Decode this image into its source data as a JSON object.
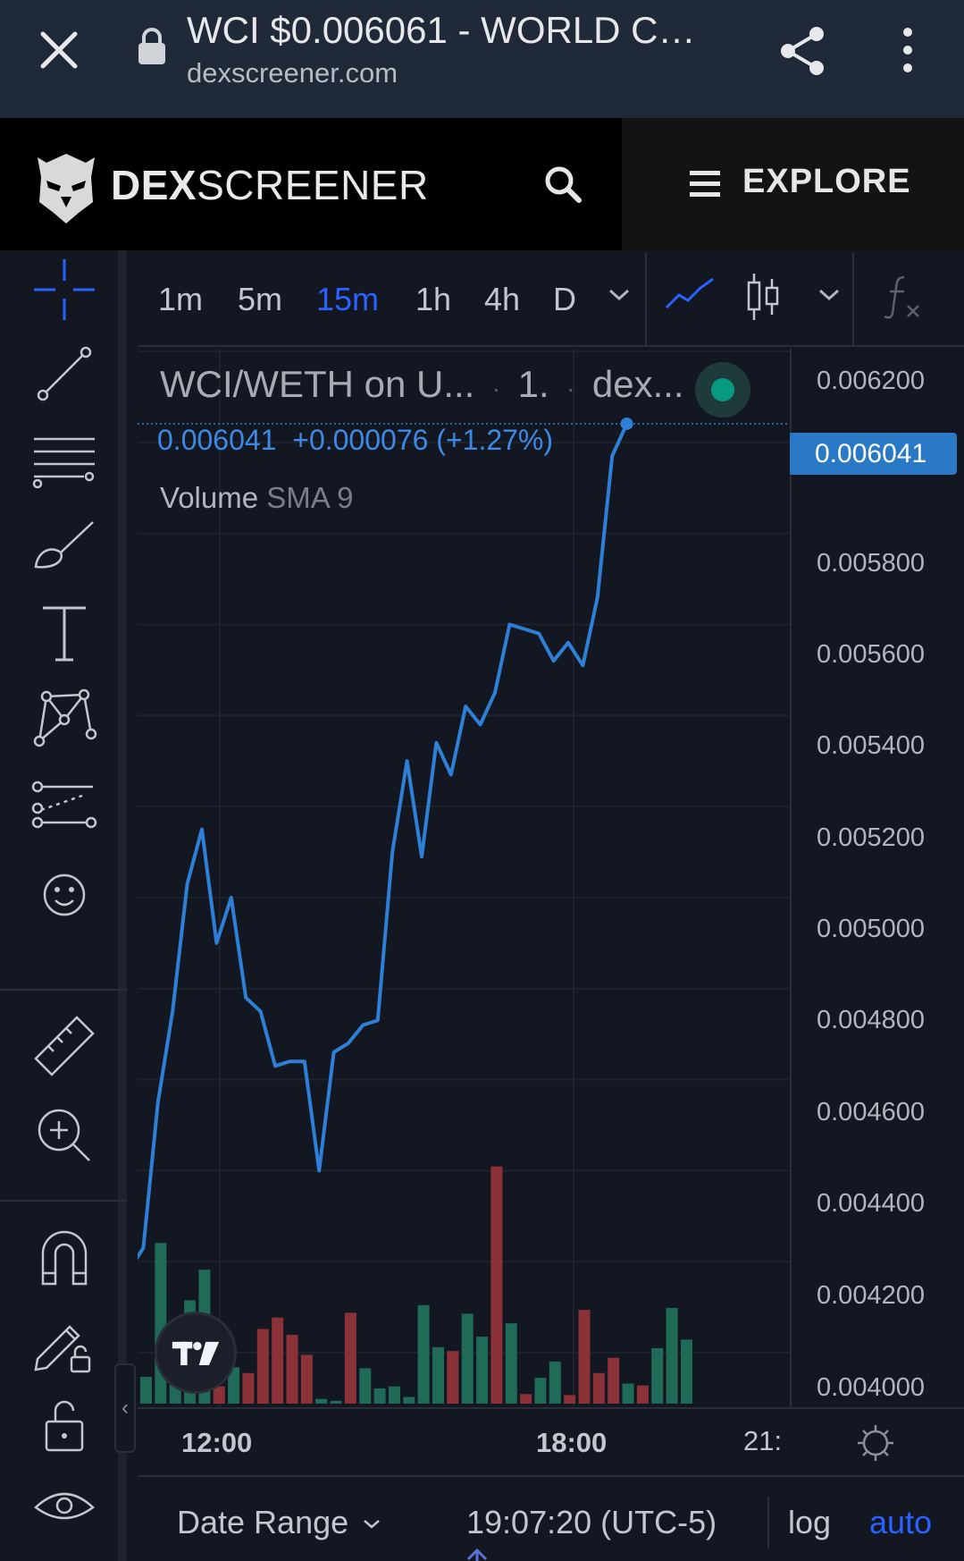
{
  "browser": {
    "title": "WCI $0.006061 - WORLD CU...",
    "domain": "dexscreener.com",
    "icons": [
      "close-icon",
      "lock-icon",
      "share-icon",
      "more-vert-icon"
    ]
  },
  "header": {
    "brand_bold": "DEX",
    "brand_rest": "SCREENER",
    "explore_label": "EXPLORE",
    "icons": [
      "eagle-logo-icon",
      "search-icon",
      "menu-icon"
    ]
  },
  "toolbar": {
    "timeframes": [
      "1m",
      "5m",
      "15m",
      "1h",
      "4h",
      "D"
    ],
    "active_timeframe": "15m",
    "icons": [
      "crosshair-icon",
      "trend-line-icon",
      "fib-lines-icon",
      "brush-icon",
      "text-icon",
      "pattern-icon",
      "forecast-icon",
      "emoji-icon",
      "ruler-icon",
      "zoom-in-icon",
      "magnet-icon",
      "lock-pencil-icon",
      "unlock-icon",
      "eye-icon",
      "line-chart-icon",
      "candles-icon",
      "indicators-icon"
    ]
  },
  "legend": {
    "pair": "WCI/WETH on U...",
    "interval": "1.",
    "source": "dex...",
    "price": "0.006041",
    "change": "+0.000076 (+1.27%)",
    "volume_label": "Volume",
    "volume_sma": "SMA 9"
  },
  "price_axis": {
    "ticks": [
      "0.006200",
      "0.005800",
      "0.005600",
      "0.005400",
      "0.005200",
      "0.005000",
      "0.004800",
      "0.004600",
      "0.004400",
      "0.004200",
      "0.004000"
    ],
    "current": "0.006041"
  },
  "time_axis": {
    "ticks": [
      "12:00",
      "18:00"
    ],
    "cut": "21:"
  },
  "bottom": {
    "date_range": "Date Range",
    "time": "19:07:20 (UTC-5)",
    "log": "log",
    "auto": "auto"
  },
  "colors": {
    "line": "#2e7fd6",
    "up": "#1f6b57",
    "down": "#8b3138",
    "accent": "#2962ff"
  },
  "chart_data": {
    "type": "line",
    "ylim": [
      0.004,
      0.0062
    ],
    "series": [
      {
        "values": [
          0.00418,
          0.00423,
          0.00455,
          0.00475,
          0.00503,
          0.00515,
          0.0049,
          0.005,
          0.00478,
          0.00475,
          0.00463,
          0.00464,
          0.00464,
          0.0044,
          0.00466,
          0.00468,
          0.00472,
          0.00473,
          0.0051,
          0.0053,
          0.00509,
          0.00534,
          0.00527,
          0.00542,
          0.00538,
          0.00545,
          0.0056,
          0.00559,
          0.00558,
          0.00552,
          0.00556,
          0.00551,
          0.00566,
          0.00597,
          0.006041
        ]
      },
      {
        "values": [
          28,
          168,
          25,
          108,
          140,
          18,
          38,
          32,
          78,
          90,
          72,
          51,
          5,
          3,
          95,
          37,
          16,
          18,
          7,
          103,
          59,
          55,
          94,
          70,
          248,
          84,
          10,
          27,
          44,
          9,
          98,
          32,
          48,
          21,
          19,
          58,
          100,
          67
        ]
      }
    ],
    "volume_up": [
      true,
      true,
      true,
      true,
      true,
      false,
      true,
      false,
      false,
      false,
      false,
      false,
      true,
      true,
      false,
      true,
      true,
      true,
      true,
      true,
      true,
      false,
      true,
      true,
      false,
      true,
      false,
      true,
      true,
      false,
      false,
      false,
      false,
      true,
      false,
      true,
      true,
      true
    ]
  }
}
